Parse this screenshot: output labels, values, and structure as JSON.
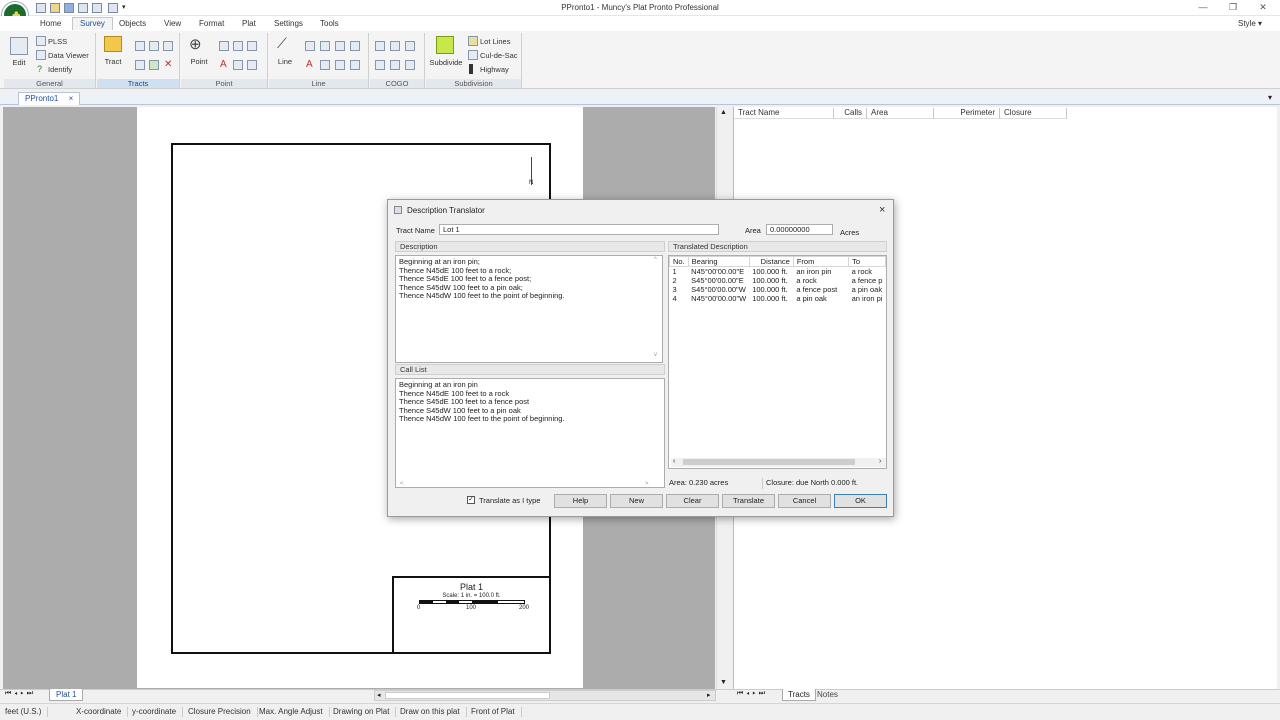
{
  "window": {
    "title": "PPronto1 - Muncy's Plat Pronto Professional",
    "style_label": "Style",
    "chev": "▾"
  },
  "ribbon_tabs": [
    "Home",
    "Survey",
    "Objects",
    "View",
    "Format",
    "Plat",
    "Settings",
    "Tools"
  ],
  "active_tab": "Survey",
  "groups": {
    "general": {
      "label": "General",
      "edit": "Edit",
      "plss": "PLSS",
      "data_viewer": "Data Viewer",
      "identify": "Identify"
    },
    "tracts": {
      "label": "Tracts",
      "tract": "Tract"
    },
    "point": {
      "label": "Point",
      "point": "Point"
    },
    "line": {
      "label": "Line",
      "line": "Line"
    },
    "cogo": {
      "label": "COGO"
    },
    "subdivision": {
      "label": "Subdivision",
      "subdivide": "Subdivide",
      "lot_lines": "Lot Lines",
      "cul_de_sac": "Cul-de-Sac",
      "highway": "Highway"
    }
  },
  "doc_tab": {
    "label": "PPronto1",
    "close": "×"
  },
  "plat": {
    "north": "N",
    "title": "Plat 1",
    "scale": "Scale: 1 in. = 100.0 ft.",
    "ticks": [
      "0",
      "100",
      "200"
    ]
  },
  "right_panel": {
    "columns": [
      "Tract Name",
      "Calls",
      "Area",
      "Perimeter",
      "Closure"
    ]
  },
  "bottom": {
    "plat_tab": "Plat 1",
    "tracts_tab": "Tracts",
    "notes_tab": "Notes"
  },
  "status": [
    "feet (U.S.)",
    "X-coordinate",
    "y-coordinate",
    "Closure Precision",
    "Max. Angle Adjust",
    "Drawing on Plat",
    "Draw on this plat",
    "Front of Plat"
  ],
  "dialog": {
    "title": "Description Translator",
    "close": "×",
    "tract_name_label": "Tract Name",
    "tract_name_value": "Lot 1",
    "area_label": "Area",
    "area_value": "0.00000000",
    "area_unit": "Acres",
    "description_label": "Description",
    "description_text": "Beginning at an iron pin;\nThence N45dE 100 feet to a rock;\nThence S45dE 100 feet to a fence post;\nThence S45dW 100 feet to a pin oak;\nThence N45dW 100 feet to the point of beginning.",
    "call_list_label": "Call List",
    "call_list_text": "Beginning at an iron pin\nThence N45dE 100 feet to a rock\nThence S45dE 100 feet to a fence post\nThence S45dW 100 feet to a pin oak\nThence N45dW 100 feet to the point of beginning.",
    "translated_label": "Translated Description",
    "table_headers": [
      "No.",
      "Bearing",
      "Distance",
      "From",
      "To"
    ],
    "table_rows": [
      [
        "1",
        "N45°00'00.00\"E",
        "100.000 ft.",
        "an iron pin",
        "a rock"
      ],
      [
        "2",
        "S45°00'00.00\"E",
        "100.000 ft.",
        "a rock",
        "a fence p"
      ],
      [
        "3",
        "S45°00'00.00\"W",
        "100.000 ft.",
        "a fence post",
        "a pin oak"
      ],
      [
        "4",
        "N45°00'00.00\"W",
        "100.000 ft.",
        "a pin oak",
        "an iron pi"
      ]
    ],
    "area_status": "Area: 0.230 acres",
    "closure_status": "Closure: due North 0.000 ft.",
    "translate_check_label": "Translate as I type",
    "buttons": {
      "help": "Help",
      "new": "New",
      "clear": "Clear",
      "translate": "Translate",
      "cancel": "Cancel",
      "ok": "OK"
    }
  }
}
